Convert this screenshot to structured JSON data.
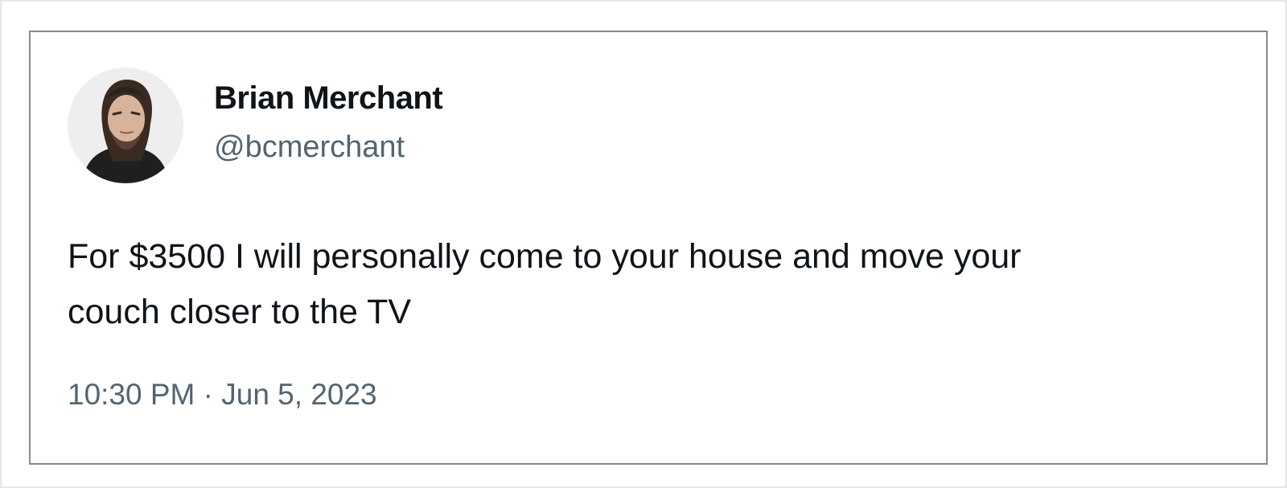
{
  "author": {
    "display_name": "Brian Merchant",
    "handle": "@bcmerchant"
  },
  "tweet": {
    "text_lines": [
      "For $3500 I will personally come to your house and move your",
      "couch closer to the TV"
    ],
    "timestamp": "10:30 PM · Jun 5, 2023"
  },
  "colors": {
    "text_primary": "#0f1419",
    "text_secondary": "#536471",
    "card_border": "#8a8a8a",
    "card_background": "#ffffff"
  }
}
